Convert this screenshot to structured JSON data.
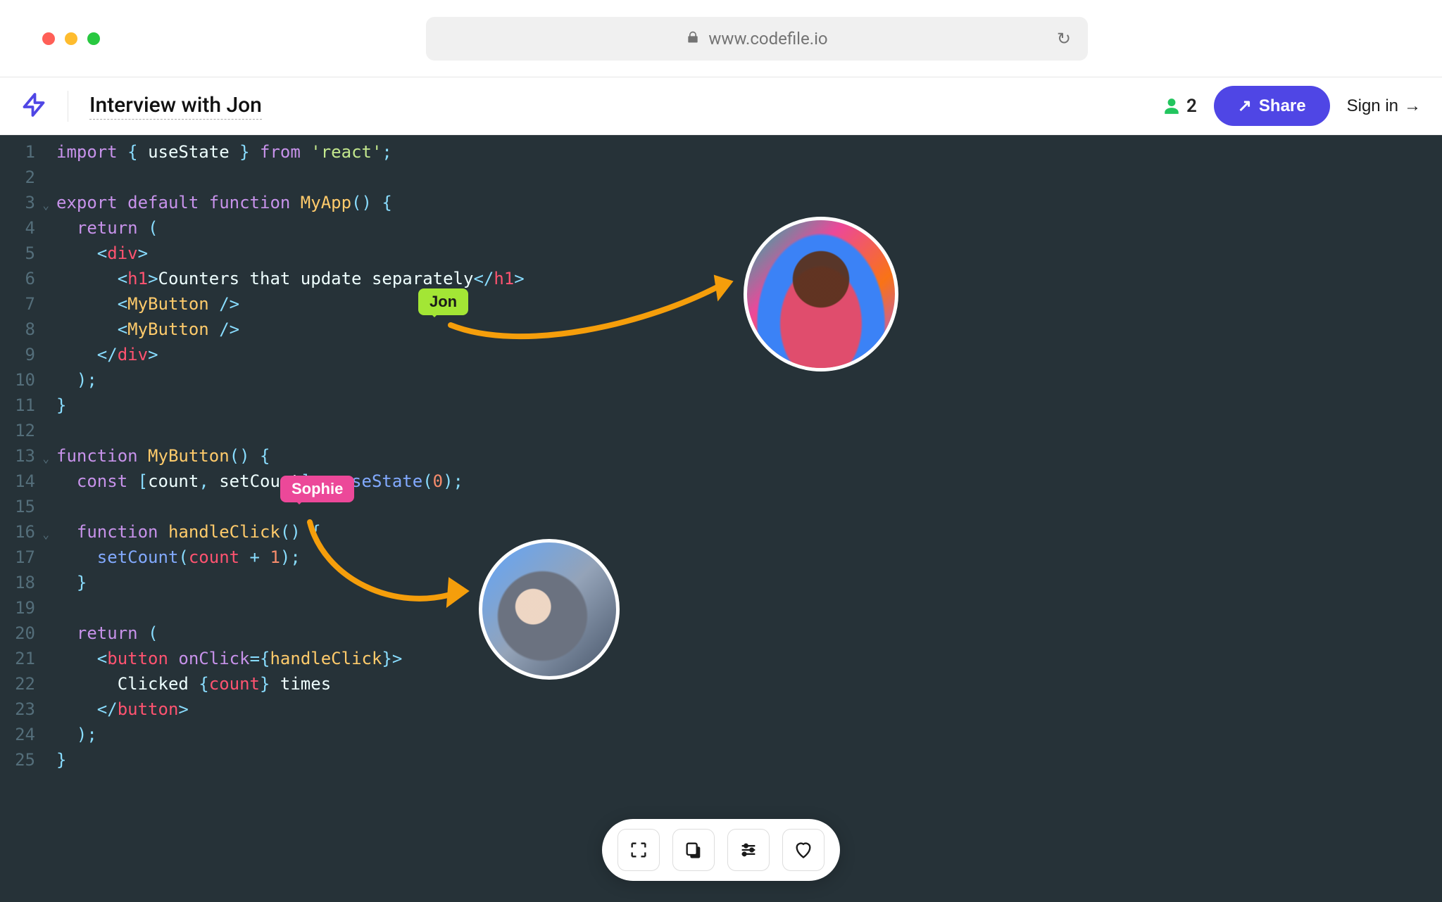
{
  "browser": {
    "url": "www.codefile.io"
  },
  "header": {
    "doc_title": "Interview with Jon",
    "user_count": "2",
    "share_label": "Share",
    "signin_label": "Sign in"
  },
  "cursors": {
    "jon_label": "Jon",
    "sophie_label": "Sophie"
  },
  "code": {
    "lines": [
      {
        "n": "1",
        "tokens": [
          {
            "t": "import",
            "c": "keyword"
          },
          {
            "t": " ",
            "c": "text"
          },
          {
            "t": "{ ",
            "c": "punc"
          },
          {
            "t": "useState",
            "c": "text"
          },
          {
            "t": " }",
            "c": "punc"
          },
          {
            "t": " ",
            "c": "text"
          },
          {
            "t": "from",
            "c": "keyword"
          },
          {
            "t": " ",
            "c": "text"
          },
          {
            "t": "'react'",
            "c": "string"
          },
          {
            "t": ";",
            "c": "punc"
          }
        ]
      },
      {
        "n": "2",
        "tokens": []
      },
      {
        "n": "3",
        "fold": true,
        "tokens": [
          {
            "t": "export default ",
            "c": "keyword"
          },
          {
            "t": "function ",
            "c": "keyword"
          },
          {
            "t": "MyApp",
            "c": "func"
          },
          {
            "t": "() {",
            "c": "punc"
          }
        ]
      },
      {
        "n": "4",
        "tokens": [
          {
            "t": "  ",
            "c": "text"
          },
          {
            "t": "return ",
            "c": "keyword"
          },
          {
            "t": "(",
            "c": "punc"
          }
        ]
      },
      {
        "n": "5",
        "tokens": [
          {
            "t": "    ",
            "c": "text"
          },
          {
            "t": "<",
            "c": "punc"
          },
          {
            "t": "div",
            "c": "tag"
          },
          {
            "t": ">",
            "c": "punc"
          }
        ]
      },
      {
        "n": "6",
        "tokens": [
          {
            "t": "      ",
            "c": "text"
          },
          {
            "t": "<",
            "c": "punc"
          },
          {
            "t": "h1",
            "c": "tag"
          },
          {
            "t": ">",
            "c": "punc"
          },
          {
            "t": "Counters that update separately",
            "c": "text"
          },
          {
            "t": "</",
            "c": "punc"
          },
          {
            "t": "h1",
            "c": "tag"
          },
          {
            "t": ">",
            "c": "punc"
          }
        ]
      },
      {
        "n": "7",
        "tokens": [
          {
            "t": "      ",
            "c": "text"
          },
          {
            "t": "<",
            "c": "punc"
          },
          {
            "t": "MyButton",
            "c": "func"
          },
          {
            "t": " />",
            "c": "punc"
          }
        ]
      },
      {
        "n": "8",
        "tokens": [
          {
            "t": "      ",
            "c": "text"
          },
          {
            "t": "<",
            "c": "punc"
          },
          {
            "t": "MyButton",
            "c": "func"
          },
          {
            "t": " />",
            "c": "punc"
          }
        ]
      },
      {
        "n": "9",
        "tokens": [
          {
            "t": "    ",
            "c": "text"
          },
          {
            "t": "</",
            "c": "punc"
          },
          {
            "t": "div",
            "c": "tag"
          },
          {
            "t": ">",
            "c": "punc"
          }
        ]
      },
      {
        "n": "10",
        "tokens": [
          {
            "t": "  ",
            "c": "text"
          },
          {
            "t": ");",
            "c": "punc"
          }
        ]
      },
      {
        "n": "11",
        "tokens": [
          {
            "t": "}",
            "c": "punc"
          }
        ]
      },
      {
        "n": "12",
        "tokens": []
      },
      {
        "n": "13",
        "fold": true,
        "tokens": [
          {
            "t": "function ",
            "c": "keyword"
          },
          {
            "t": "MyButton",
            "c": "func"
          },
          {
            "t": "() {",
            "c": "punc"
          }
        ]
      },
      {
        "n": "14",
        "tokens": [
          {
            "t": "  ",
            "c": "text"
          },
          {
            "t": "const ",
            "c": "keyword"
          },
          {
            "t": "[",
            "c": "punc"
          },
          {
            "t": "count",
            "c": "text"
          },
          {
            "t": ", ",
            "c": "punc"
          },
          {
            "t": "setCount",
            "c": "text"
          },
          {
            "t": "] = ",
            "c": "punc"
          },
          {
            "t": "useState",
            "c": "prop"
          },
          {
            "t": "(",
            "c": "punc"
          },
          {
            "t": "0",
            "c": "num"
          },
          {
            "t": ");",
            "c": "punc"
          }
        ]
      },
      {
        "n": "15",
        "tokens": []
      },
      {
        "n": "16",
        "fold": true,
        "tokens": [
          {
            "t": "  ",
            "c": "text"
          },
          {
            "t": "function ",
            "c": "keyword"
          },
          {
            "t": "handleClick",
            "c": "func"
          },
          {
            "t": "() {",
            "c": "punc"
          }
        ]
      },
      {
        "n": "17",
        "tokens": [
          {
            "t": "    ",
            "c": "text"
          },
          {
            "t": "setCount",
            "c": "prop"
          },
          {
            "t": "(",
            "c": "punc"
          },
          {
            "t": "count",
            "c": "tag"
          },
          {
            "t": " + ",
            "c": "punc"
          },
          {
            "t": "1",
            "c": "num"
          },
          {
            "t": ");",
            "c": "punc"
          }
        ]
      },
      {
        "n": "18",
        "tokens": [
          {
            "t": "  ",
            "c": "text"
          },
          {
            "t": "}",
            "c": "punc"
          }
        ]
      },
      {
        "n": "19",
        "tokens": []
      },
      {
        "n": "20",
        "tokens": [
          {
            "t": "  ",
            "c": "text"
          },
          {
            "t": "return ",
            "c": "keyword"
          },
          {
            "t": "(",
            "c": "punc"
          }
        ]
      },
      {
        "n": "21",
        "tokens": [
          {
            "t": "    ",
            "c": "text"
          },
          {
            "t": "<",
            "c": "punc"
          },
          {
            "t": "button",
            "c": "tag"
          },
          {
            "t": " ",
            "c": "text"
          },
          {
            "t": "onClick",
            "c": "attr"
          },
          {
            "t": "=",
            "c": "punc"
          },
          {
            "t": "{",
            "c": "punc"
          },
          {
            "t": "handleClick",
            "c": "val"
          },
          {
            "t": "}",
            "c": "punc"
          },
          {
            "t": ">",
            "c": "punc"
          }
        ]
      },
      {
        "n": "22",
        "tokens": [
          {
            "t": "      Clicked ",
            "c": "text"
          },
          {
            "t": "{",
            "c": "punc"
          },
          {
            "t": "count",
            "c": "tag"
          },
          {
            "t": "}",
            "c": "punc"
          },
          {
            "t": " times",
            "c": "text"
          }
        ]
      },
      {
        "n": "23",
        "tokens": [
          {
            "t": "    ",
            "c": "text"
          },
          {
            "t": "</",
            "c": "punc"
          },
          {
            "t": "button",
            "c": "tag"
          },
          {
            "t": ">",
            "c": "punc"
          }
        ]
      },
      {
        "n": "24",
        "tokens": [
          {
            "t": "  ",
            "c": "text"
          },
          {
            "t": ");",
            "c": "punc"
          }
        ]
      },
      {
        "n": "25",
        "tokens": [
          {
            "t": "}",
            "c": "punc"
          }
        ]
      }
    ]
  },
  "toolbar": {
    "items": [
      "fullscreen",
      "copy",
      "settings",
      "favorite"
    ]
  }
}
